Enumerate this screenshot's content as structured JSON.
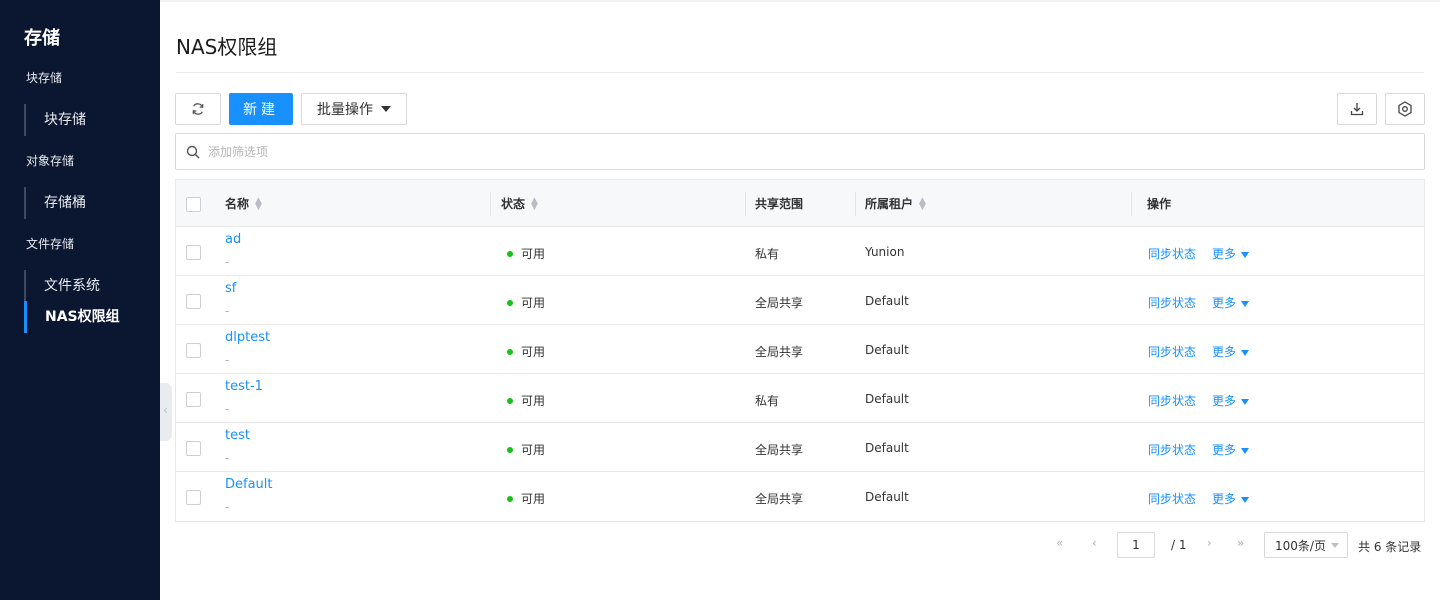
{
  "sidebar": {
    "title": "存储",
    "groups": [
      {
        "label": "块存储",
        "items": [
          {
            "label": "块存储"
          }
        ]
      },
      {
        "label": "对象存储",
        "items": [
          {
            "label": "存储桶"
          }
        ]
      },
      {
        "label": "文件存储",
        "items": [
          {
            "label": "文件系统"
          },
          {
            "label": "NAS权限组",
            "active": true
          }
        ]
      }
    ]
  },
  "page": {
    "title": "NAS权限组"
  },
  "toolbar": {
    "new_label": "新建",
    "batch_label": "批量操作"
  },
  "search": {
    "placeholder": "添加筛选项"
  },
  "table": {
    "headers": {
      "name": "名称",
      "status": "状态",
      "scope": "共享范围",
      "tenant": "所属租户",
      "actions": "操作"
    },
    "rows": [
      {
        "name": "ad",
        "sub": "-",
        "status": "可用",
        "scope": "私有",
        "tenant": "Yunion",
        "sync": "同步状态",
        "more": "更多"
      },
      {
        "name": "sf",
        "sub": "-",
        "status": "可用",
        "scope": "全局共享",
        "tenant": "Default",
        "sync": "同步状态",
        "more": "更多"
      },
      {
        "name": "dlptest",
        "sub": "-",
        "status": "可用",
        "scope": "全局共享",
        "tenant": "Default",
        "sync": "同步状态",
        "more": "更多"
      },
      {
        "name": "test-1",
        "sub": "-",
        "status": "可用",
        "scope": "私有",
        "tenant": "Default",
        "sync": "同步状态",
        "more": "更多"
      },
      {
        "name": "test",
        "sub": "-",
        "status": "可用",
        "scope": "全局共享",
        "tenant": "Default",
        "sync": "同步状态",
        "more": "更多"
      },
      {
        "name": "Default",
        "sub": "-",
        "status": "可用",
        "scope": "全局共享",
        "tenant": "Default",
        "sync": "同步状态",
        "more": "更多"
      }
    ]
  },
  "pagination": {
    "current": "1",
    "total_pages": "/ 1",
    "page_size": "100条/页",
    "total_text": "共 6 条记录"
  },
  "colors": {
    "accent": "#1890ff",
    "sidebar_bg": "#0b1730",
    "status_ok": "#19c216"
  }
}
